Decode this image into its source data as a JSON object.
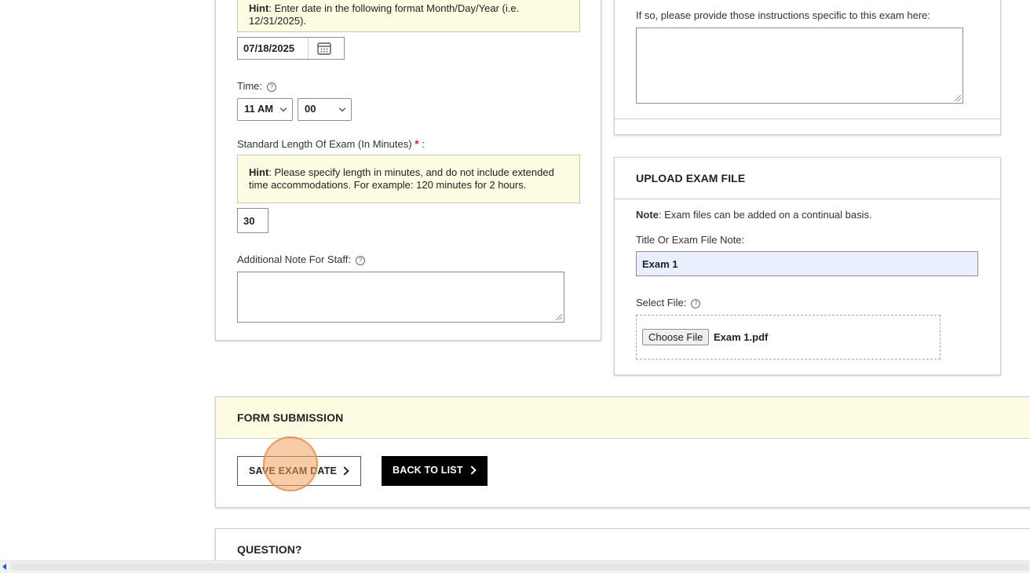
{
  "left_panel": {
    "date_hint_bold": "Hint",
    "date_hint_text": ": Enter date in the following format Month/Day/Year (i.e.",
    "date_hint_example": "12/31/2025).",
    "date_value": "07/18/2025",
    "time_label": "Time:",
    "time_hour": "11 AM",
    "time_minute": "00",
    "length_label": "Standard Length Of Exam (In Minutes)",
    "length_required": "*",
    "length_colon": ":",
    "length_hint_bold": "Hint",
    "length_hint_line1": ": Please specify length in minutes, and do not include extended",
    "length_hint_line2": "time accommodations. For example: 120 minutes for 2 hours.",
    "length_value": "30",
    "note_label": "Additional Note For Staff:",
    "note_value": ""
  },
  "right_panel": {
    "instructions_label": "If so, please provide those instructions specific to this exam here:",
    "instructions_value": ""
  },
  "upload": {
    "title": "UPLOAD EXAM FILE",
    "note_bold": "Note",
    "note_text": ": Exam files can be added on a continual basis.",
    "title_label": "Title Or Exam File Note:",
    "title_value": "Exam 1",
    "select_label": "Select File:",
    "choose_button": "Choose File",
    "file_name": "Exam 1.pdf"
  },
  "submission": {
    "title": "FORM SUBMISSION",
    "save_label": "SAVE EXAM DATE",
    "back_label": "BACK TO LIST"
  },
  "question": {
    "title": "QUESTION?"
  },
  "colors": {
    "hint_bg": "#fcfce3",
    "submission_header_bg": "#fdfbe1",
    "title_input_bg": "#e8f0fe",
    "back_button_bg": "#000000",
    "click_indicator": "#f0a35e"
  }
}
